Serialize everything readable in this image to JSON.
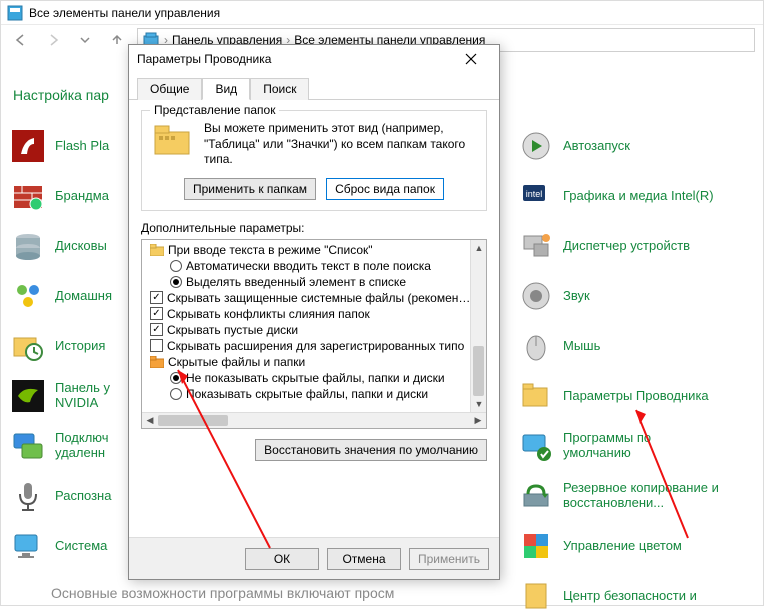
{
  "bg_window": {
    "title": "Все элементы панели управления",
    "breadcrumb": {
      "part1": "Панель управления",
      "part2": "Все элементы панели управления"
    },
    "heading": "Настройка пар",
    "left_items": [
      {
        "label": "Flash Pla"
      },
      {
        "label": "Брандма"
      },
      {
        "label": "Дисковы"
      },
      {
        "label": "Домашня"
      },
      {
        "label": "История"
      },
      {
        "label": "Панель у\nNVIDIA"
      },
      {
        "label": "Подключ\nудаленн"
      },
      {
        "label": "Распозна"
      },
      {
        "label": "Система"
      }
    ],
    "right_items": [
      {
        "label": "Автозапуск"
      },
      {
        "label": "Графика и медиа Intel(R)"
      },
      {
        "label": "Диспетчер устройств"
      },
      {
        "label": "Звук"
      },
      {
        "label": "Мышь"
      },
      {
        "label": "Параметры Проводника"
      },
      {
        "label": "Программы по\nумолчанию"
      },
      {
        "label": "Резервное копирование и\nвосстановлени..."
      },
      {
        "label": "Управление цветом"
      },
      {
        "label": "Центр безопасности и"
      }
    ],
    "footer_text": "Основные возможности программы включают просм"
  },
  "dialog": {
    "title": "Параметры Проводника",
    "tabs": {
      "general": "Общие",
      "view": "Вид",
      "search": "Поиск"
    },
    "group_legend": "Представление папок",
    "group_text": "Вы можете применить этот вид (например, \"Таблица\" или \"Значки\") ко всем папкам такого типа.",
    "btn_apply_folders": "Применить к папкам",
    "btn_reset_folders": "Сброс вида папок",
    "adv_label": "Дополнительные параметры:",
    "tree": {
      "r0": "При вводе текста в режиме \"Список\"",
      "r1": "Автоматически вводить текст в поле поиска",
      "r2": "Выделять введенный элемент в списке",
      "r3": "Скрывать защищенные системные файлы (рекомен…",
      "r4": "Скрывать конфликты слияния папок",
      "r5": "Скрывать пустые диски",
      "r6": "Скрывать расширения для зарегистрированных типо",
      "r7": "Скрытые файлы и папки",
      "r8": "Не показывать скрытые файлы, папки и диски",
      "r9": "Показывать скрытые файлы, папки и диски"
    },
    "btn_restore": "Восстановить значения по умолчанию",
    "btn_ok": "ОК",
    "btn_cancel": "Отмена",
    "btn_apply": "Применить"
  }
}
